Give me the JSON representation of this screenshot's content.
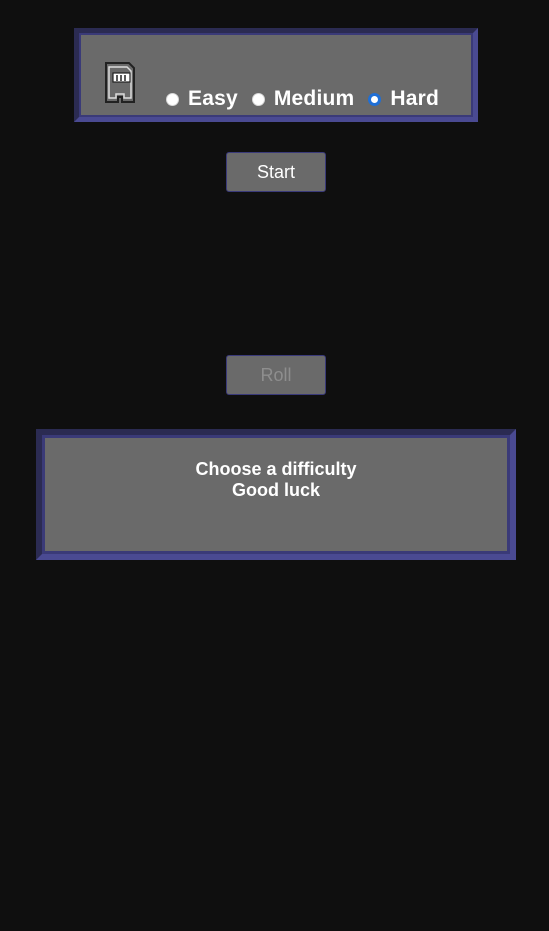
{
  "difficulty": {
    "icon": "sd-card-icon",
    "options": [
      {
        "label": "Easy",
        "checked": false
      },
      {
        "label": "Medium",
        "checked": false
      },
      {
        "label": "Hard",
        "checked": true
      }
    ]
  },
  "controls": {
    "start_label": "Start",
    "roll_label": "Roll"
  },
  "message": {
    "line1": "Choose a difficulty",
    "line2": "Good luck"
  },
  "colors": {
    "background": "#0f0f0f",
    "panel": "#6a6a6a",
    "panel_border": "#4a4a92",
    "radio_checked": "#1f6fd6"
  }
}
